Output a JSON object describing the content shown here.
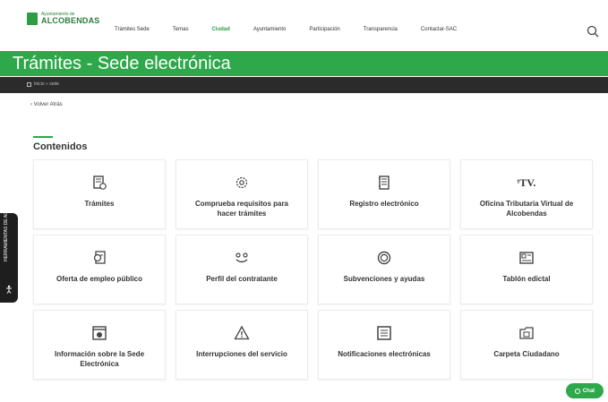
{
  "header": {
    "logo_small": "Ayuntamiento de",
    "logo_big": "ALCOBENDAS",
    "nav": [
      {
        "label": "Trámites Sede",
        "active": false
      },
      {
        "label": "Temas",
        "active": false
      },
      {
        "label": "Ciudad",
        "active": true
      },
      {
        "label": "Ayuntamiento",
        "active": false
      },
      {
        "label": "Participación",
        "active": false
      },
      {
        "label": "Transparencia",
        "active": false
      },
      {
        "label": "Contactar-SAC",
        "active": false
      }
    ],
    "search_icon": "search-icon"
  },
  "title_band": {
    "title": "Trámites - Sede electrónica",
    "color": "#2ea84a"
  },
  "breadcrumb": {
    "text": "Inicio » sede"
  },
  "back_link": "‹ Volver Atrás",
  "section_title": "Contenidos",
  "cards": [
    {
      "label": "Trámites",
      "icon": "forms-icon"
    },
    {
      "label": "Comprueba requisitos para hacer trámites",
      "icon": "gear-icon"
    },
    {
      "label": "Registro electrónico",
      "icon": "register-book-icon"
    },
    {
      "label": "Oficina Tributaria Virtual de Alcobendas",
      "icon": "tv-logo-icon",
      "icon_text": "ᵗTV."
    },
    {
      "label": "Oferta de empleo público",
      "icon": "job-offer-icon"
    },
    {
      "label": "Perfil del contratante",
      "icon": "handshake-icon"
    },
    {
      "label": "Subvenciones y ayudas",
      "icon": "coin-icon"
    },
    {
      "label": "Tablón edictal",
      "icon": "notice-board-icon"
    },
    {
      "label": "Información sobre la Sede Electrónica",
      "icon": "info-window-icon"
    },
    {
      "label": "Interrupciones del servicio",
      "icon": "warning-icon"
    },
    {
      "label": "Notificaciones electrónicas",
      "icon": "notification-icon"
    },
    {
      "label": "Carpeta Ciudadano",
      "icon": "folder-icon"
    }
  ],
  "accessibility": {
    "label": "HERRAMIENTAS DE ACCESIBILIDAD"
  },
  "chat": {
    "label": "Chat",
    "color": "#2ea84a"
  }
}
